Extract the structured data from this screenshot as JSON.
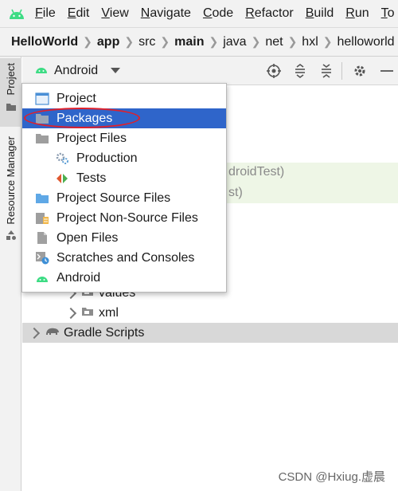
{
  "menu": {
    "items": [
      {
        "mnemonic": "F",
        "rest": "ile"
      },
      {
        "mnemonic": "E",
        "rest": "dit"
      },
      {
        "mnemonic": "V",
        "rest": "iew"
      },
      {
        "mnemonic": "N",
        "rest": "avigate"
      },
      {
        "mnemonic": "C",
        "rest": "ode"
      },
      {
        "mnemonic": "R",
        "rest": "efactor"
      },
      {
        "mnemonic": "B",
        "rest": "uild"
      },
      {
        "mnemonic": "R",
        "rest": "un"
      },
      {
        "mnemonic": "T",
        "rest": "o"
      }
    ]
  },
  "breadcrumb": [
    "HelloWorld",
    "app",
    "src",
    "main",
    "java",
    "net",
    "hxl",
    "helloworld"
  ],
  "left_strip": {
    "project_tab": "Project",
    "resource_tab": "Resource Manager"
  },
  "tool_window": {
    "view_selected": "Android"
  },
  "tree": {
    "partial_1": "droidTest)",
    "partial_2": "st)",
    "values_label": "values",
    "xml_label": "xml",
    "gradle_label": "Gradle Scripts"
  },
  "popup": {
    "items": [
      {
        "label": "Project",
        "icon": "project-view-icon"
      },
      {
        "label": "Packages",
        "icon": "folder-icon"
      },
      {
        "label": "Project Files",
        "icon": "folder-icon"
      },
      {
        "label": "Production",
        "icon": "production-gear-icon"
      },
      {
        "label": "Tests",
        "icon": "tests-icon"
      },
      {
        "label": "Project Source Files",
        "icon": "source-folder-icon"
      },
      {
        "label": "Project Non-Source Files",
        "icon": "non-source-files-icon"
      },
      {
        "label": "Open Files",
        "icon": "file-icon"
      },
      {
        "label": "Scratches and Consoles",
        "icon": "scratches-icon"
      },
      {
        "label": "Android",
        "icon": "android-icon"
      }
    ]
  },
  "watermark": "CSDN @Hxiug.虚晨",
  "colors": {
    "selection": "#2f65ca",
    "annotation": "#e0202a",
    "android_green": "#3ddc84"
  }
}
